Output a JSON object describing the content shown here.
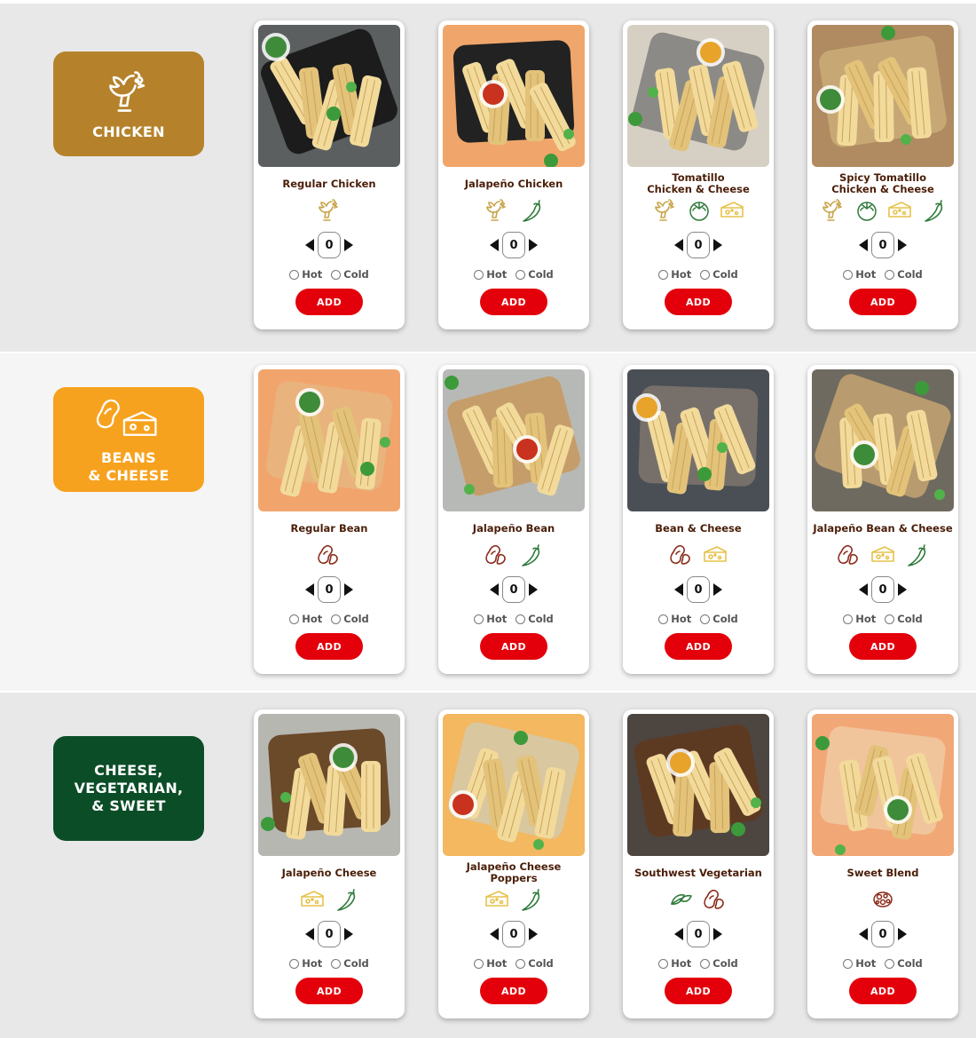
{
  "colors": {
    "chicken_badge": "#b5822b",
    "beans_badge": "#f7a21e",
    "veg_badge": "#0b4d27",
    "add_button": "#e3000b",
    "chicken_icon": "#c8a44a",
    "pepper_icon": "#2f7a3a",
    "bean_icon": "#8a2a1a",
    "cheese_icon": "#e6c24a"
  },
  "categories": [
    {
      "label": "CHICKEN",
      "icon": "chicken-icon",
      "products": [
        {
          "name": "Regular Chicken",
          "icons": [
            "chicken-icon"
          ],
          "qty": "0",
          "hot": "Hot",
          "cold": "Cold",
          "add": "ADD",
          "photo": "tamales-on-black-tray"
        },
        {
          "name": "Jalapeño Chicken",
          "icons": [
            "chicken-icon",
            "pepper-icon"
          ],
          "qty": "0",
          "hot": "Hot",
          "cold": "Cold",
          "add": "ADD",
          "photo": "tamales-with-guacamole"
        },
        {
          "name": "Tomatillo\nChicken & Cheese",
          "icons": [
            "chicken-icon",
            "tomatillo-icon",
            "cheese-icon"
          ],
          "qty": "0",
          "hot": "Hot",
          "cold": "Cold",
          "add": "ADD",
          "photo": "tamales-with-tomatillos"
        },
        {
          "name": "Spicy Tomatillo\nChicken & Cheese",
          "icons": [
            "chicken-icon",
            "tomatillo-icon",
            "cheese-icon",
            "pepper-icon"
          ],
          "qty": "0",
          "hot": "Hot",
          "cold": "Cold",
          "add": "ADD",
          "photo": "tamales-with-peppers"
        }
      ]
    },
    {
      "label": "BEANS\n& CHEESE",
      "icon": "bean-cheese-icon",
      "products": [
        {
          "name": "Regular Bean",
          "icons": [
            "bean-icon"
          ],
          "qty": "0",
          "hot": "Hot",
          "cold": "Cold",
          "add": "ADD",
          "photo": "tamales-on-peach"
        },
        {
          "name": "Jalapeño Bean",
          "icons": [
            "bean-icon",
            "pepper-icon"
          ],
          "qty": "0",
          "hot": "Hot",
          "cold": "Cold",
          "add": "ADD",
          "photo": "tamales-on-board"
        },
        {
          "name": "Bean & Cheese",
          "icons": [
            "bean-icon",
            "cheese-icon"
          ],
          "qty": "0",
          "hot": "Hot",
          "cold": "Cold",
          "add": "ADD",
          "photo": "tamales-in-dish"
        },
        {
          "name": "Jalapeño Bean & Cheese",
          "icons": [
            "bean-icon",
            "cheese-icon",
            "pepper-icon"
          ],
          "qty": "0",
          "hot": "Hot",
          "cold": "Cold",
          "add": "ADD",
          "photo": "tamales-with-cheddar"
        }
      ]
    },
    {
      "label": "CHEESE,\nVEGETARIAN,\n& SWEET",
      "icon": "",
      "products": [
        {
          "name": "Jalapeño Cheese",
          "icons": [
            "cheese-icon",
            "pepper-icon"
          ],
          "qty": "0",
          "hot": "Hot",
          "cold": "Cold",
          "add": "ADD",
          "photo": "tamales-on-wood-plate"
        },
        {
          "name": "Jalapeño Cheese Poppers",
          "icons": [
            "cheese-icon",
            "pepper-icon"
          ],
          "qty": "0",
          "hot": "Hot",
          "cold": "Cold",
          "add": "ADD",
          "photo": "poppers-with-salsa"
        },
        {
          "name": "Southwest Vegetarian",
          "icons": [
            "leaf-icon",
            "bean-icon"
          ],
          "qty": "0",
          "hot": "Hot",
          "cold": "Cold",
          "add": "ADD",
          "photo": "tamales-with-corn-salsa"
        },
        {
          "name": "Sweet Blend",
          "icons": [
            "sweet-blend-icon"
          ],
          "qty": "0",
          "hot": "Hot",
          "cold": "Cold",
          "add": "ADD",
          "photo": "open-sweet-tamale"
        }
      ]
    }
  ]
}
